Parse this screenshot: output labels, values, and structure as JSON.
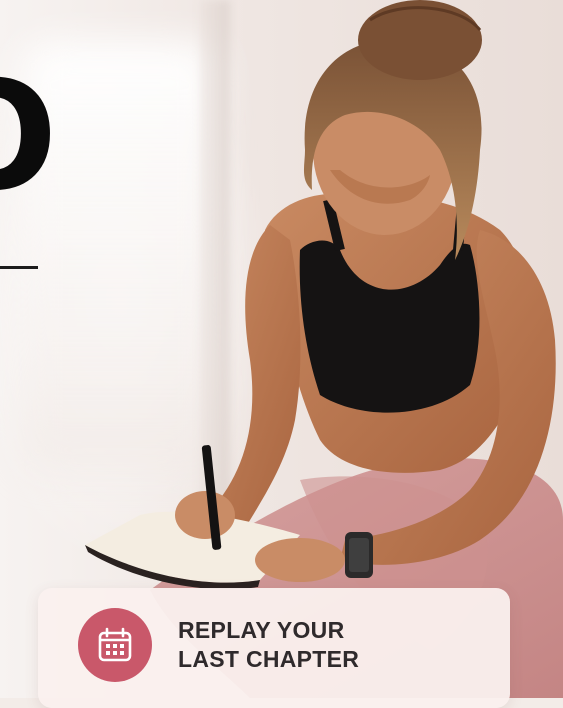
{
  "headline": {
    "partial_letter": "O"
  },
  "photo": {
    "subject": "woman-writing-in-journal"
  },
  "card": {
    "icon": "calendar-icon",
    "line1": "REPLAY YOUR",
    "line2": "LAST CHAPTER",
    "colors": {
      "icon_background": "#c9586a",
      "card_background": "#faf0ee",
      "text": "#2f2a2c"
    }
  }
}
